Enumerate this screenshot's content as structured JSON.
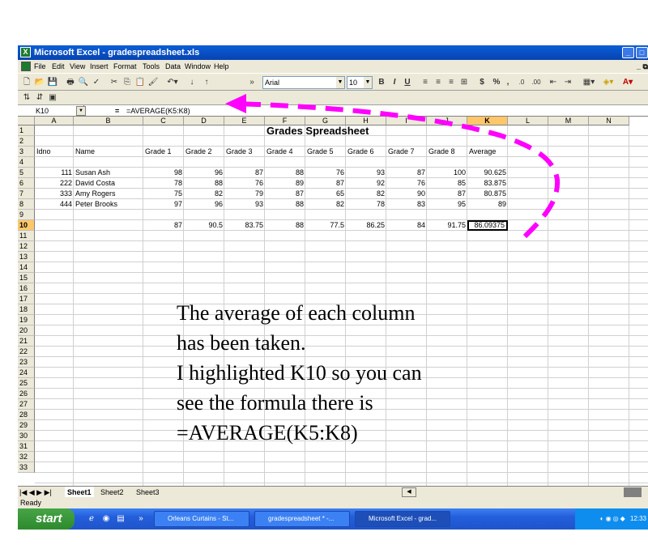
{
  "window": {
    "title": "Microsoft Excel - gradespreadsheet.xls",
    "app_icon": "excel-icon"
  },
  "menu": [
    "File",
    "Edit",
    "View",
    "Insert",
    "Format",
    "Tools",
    "Data",
    "Window",
    "Help"
  ],
  "toolbar": {
    "font_name": "Arial",
    "font_size": "10",
    "bold": "B",
    "italic": "I",
    "underline": "U",
    "currency": "$",
    "percent": "%",
    "comma": ","
  },
  "formula_bar": {
    "name_box": "K10",
    "equals": "=",
    "formula": "=AVERAGE(K5:K8)"
  },
  "spreadsheet": {
    "columns": [
      "A",
      "B",
      "C",
      "D",
      "E",
      "F",
      "G",
      "H",
      "I",
      "J",
      "K",
      "L",
      "M",
      "N"
    ],
    "row_numbers": [
      "1",
      "2",
      "3",
      "4",
      "5",
      "6",
      "7",
      "8",
      "9",
      "10",
      "11",
      "12",
      "13",
      "14",
      "15",
      "16",
      "17",
      "18",
      "19",
      "20",
      "21",
      "22",
      "23",
      "24",
      "25",
      "26",
      "27",
      "28",
      "29",
      "30",
      "31",
      "32",
      "33"
    ],
    "title": "Grades Spreadsheet",
    "headers": [
      "Idno",
      "Name",
      "Grade 1",
      "Grade 2",
      "Grade 3",
      "Grade 4",
      "Grade 5",
      "Grade 6",
      "Grade 7",
      "Grade 8",
      "Average"
    ],
    "rows": [
      [
        "111",
        "Susan Ash",
        "98",
        "96",
        "87",
        "88",
        "76",
        "93",
        "87",
        "100",
        "90.625"
      ],
      [
        "222",
        "David Costa",
        "78",
        "88",
        "76",
        "89",
        "87",
        "92",
        "76",
        "85",
        "83.875"
      ],
      [
        "333",
        "Amy Rogers",
        "75",
        "82",
        "79",
        "87",
        "65",
        "82",
        "90",
        "87",
        "80.875"
      ],
      [
        "444",
        "Peter Brooks",
        "97",
        "96",
        "93",
        "88",
        "82",
        "78",
        "83",
        "95",
        "89"
      ]
    ],
    "averages": [
      "87",
      "90.5",
      "83.75",
      "88",
      "77.5",
      "86.25",
      "84",
      "91.75",
      "86.09375"
    ]
  },
  "sheet_tabs": [
    "Sheet1",
    "Sheet2",
    "Sheet3"
  ],
  "status": "Ready",
  "taskbar": {
    "start": "start",
    "tasks": [
      "Orleans Curtains - St...",
      "gradespreadsheet * -...",
      "Microsoft Excel - grad..."
    ],
    "clock": "12:33"
  },
  "annotation": {
    "lines": [
      "The average of each column",
      "has been taken.",
      "I highlighted K10 so you can",
      "see the formula there is",
      "=AVERAGE(K5:K8)"
    ],
    "arrow_color": "#ff00ff"
  }
}
